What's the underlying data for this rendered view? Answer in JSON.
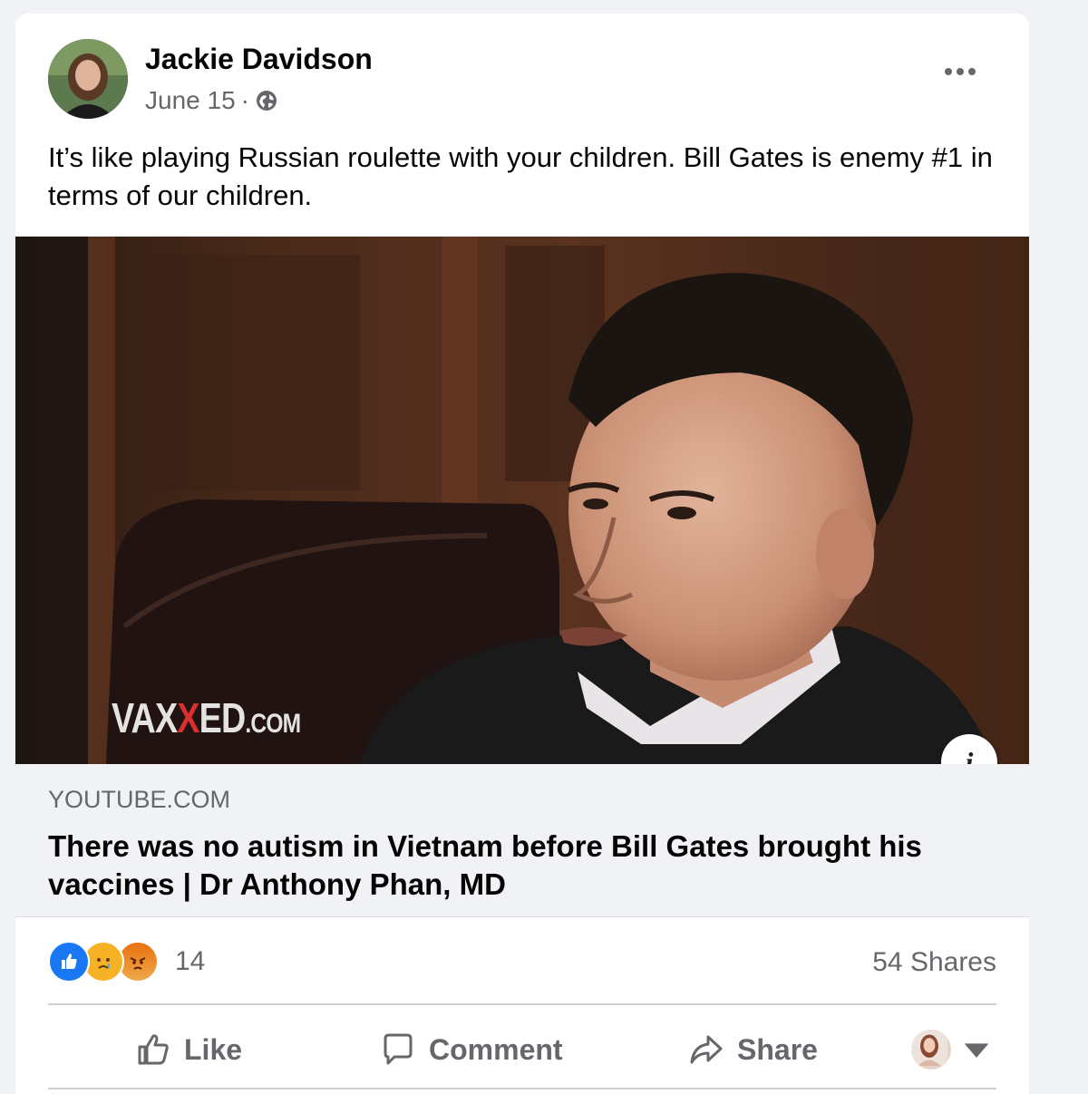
{
  "post": {
    "author": "Jackie Davidson",
    "date": "June 15",
    "date_separator": "·",
    "privacy_icon": "globe-icon",
    "more_icon": "more-options-icon",
    "text": "It’s like playing Russian roulette with your children. Bill Gates is enemy #1 in terms of our children."
  },
  "media": {
    "watermark_pre": "VAX",
    "watermark_x": "X",
    "watermark_post": "ED",
    "watermark_suffix": ".COM",
    "info_label": "i"
  },
  "link": {
    "domain": "YOUTUBE.COM",
    "title": "There was no autism in Vietnam before Bill Gates brought his vaccines | Dr Anthony Phan, MD"
  },
  "stats": {
    "reaction_icons": [
      "like-icon",
      "care-sad-icon",
      "angry-icon"
    ],
    "reaction_count": "14",
    "shares": "54 Shares"
  },
  "actions": {
    "like": "Like",
    "comment": "Comment",
    "share": "Share"
  },
  "colors": {
    "background": "#f0f2f5",
    "secondary_text": "#65676b",
    "like_blue": "#1877f2",
    "sad_yellow": "#f7b125",
    "angry_orange": "#e9710f"
  }
}
